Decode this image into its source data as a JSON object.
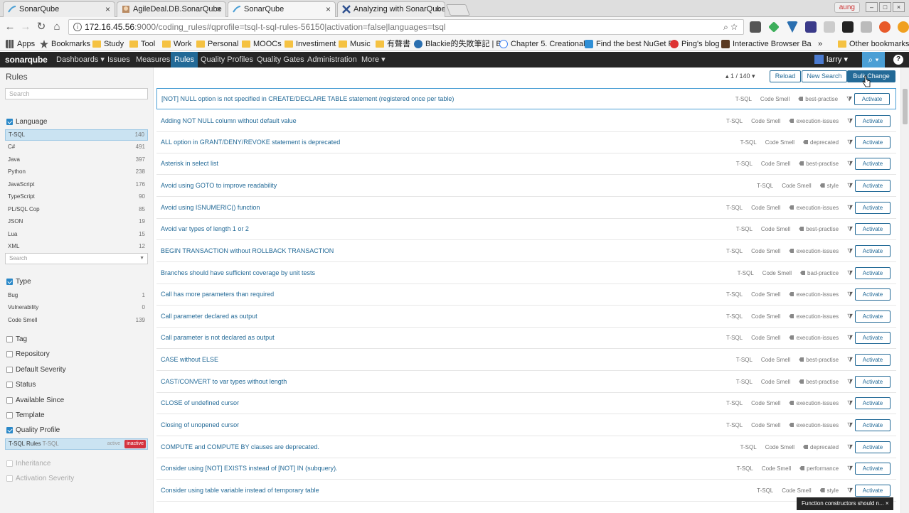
{
  "browser": {
    "tabs": [
      {
        "title": "SonarQube"
      },
      {
        "title": "AgileDeal.DB.SonarQube"
      },
      {
        "title": "SonarQube"
      },
      {
        "title": "Analyzing with SonarQube"
      }
    ],
    "user_chip": "aung",
    "url_host": "172.16.45.56",
    "url_path": ":9000/coding_rules#qprofile=tsql-t-sql-rules-56150|activation=false|languages=tsql",
    "bookmarks": [
      {
        "label": "Apps",
        "kind": "grid"
      },
      {
        "label": "Bookmarks",
        "kind": "star"
      },
      {
        "label": "Study",
        "kind": "folder"
      },
      {
        "label": "Tool",
        "kind": "folder"
      },
      {
        "label": "Work",
        "kind": "folder"
      },
      {
        "label": "Personal",
        "kind": "folder"
      },
      {
        "label": "MOOCs",
        "kind": "folder"
      },
      {
        "label": "Investiment",
        "kind": "folder"
      },
      {
        "label": "Music",
        "kind": "folder"
      },
      {
        "label": "有聲書",
        "kind": "folder"
      },
      {
        "label": "Blackie的失敗筆記 | Bl",
        "kind": "site"
      },
      {
        "label": "Chapter 5. Creational",
        "kind": "site"
      },
      {
        "label": "Find the best NuGet P",
        "kind": "site"
      },
      {
        "label": "Ping's blog",
        "kind": "site"
      },
      {
        "label": "Interactive Browser Ba",
        "kind": "site"
      },
      {
        "label": "»",
        "kind": "more"
      },
      {
        "label": "Other bookmarks",
        "kind": "folder"
      }
    ]
  },
  "nav": {
    "logo": "sonarqube",
    "items": [
      "Dashboards ▾",
      "Issues",
      "Measures",
      "Rules",
      "Quality Profiles",
      "Quality Gates",
      "Administration",
      "More ▾"
    ],
    "active": "Rules",
    "user": "larry ▾",
    "search_icon": "search-icon",
    "help": "?"
  },
  "sidebar": {
    "title": "Rules",
    "search_placeholder": "Search",
    "language": {
      "label": "Language",
      "items": [
        {
          "name": "T-SQL",
          "count": "140"
        },
        {
          "name": "C#",
          "count": "491"
        },
        {
          "name": "Java",
          "count": "397"
        },
        {
          "name": "Python",
          "count": "238"
        },
        {
          "name": "JavaScript",
          "count": "176"
        },
        {
          "name": "TypeScript",
          "count": "90"
        },
        {
          "name": "PL/SQL Cop",
          "count": "85"
        },
        {
          "name": "JSON",
          "count": "19"
        },
        {
          "name": "Lua",
          "count": "15"
        },
        {
          "name": "XML",
          "count": "12"
        }
      ],
      "select_placeholder": "Search"
    },
    "type": {
      "label": "Type",
      "items": [
        {
          "name": "Bug",
          "count": "1"
        },
        {
          "name": "Vulnerability",
          "count": "0"
        },
        {
          "name": "Code Smell",
          "count": "139"
        }
      ]
    },
    "collapsed_facets": [
      "Tag",
      "Repository",
      "Default Severity",
      "Status",
      "Available Since",
      "Template"
    ],
    "quality_profile": {
      "label": "Quality Profile",
      "profile": "T-SQL Rules",
      "lang": "T-SQL",
      "active": "active",
      "inactive": "inactive"
    },
    "disabled_facets": [
      "Inheritance",
      "Activation Severity"
    ]
  },
  "main": {
    "pager": "▴ 1 / 140 ▾",
    "buttons": {
      "reload": "Reload",
      "new_search": "New Search",
      "bulk_change": "Bulk Change"
    },
    "activate_label": "Activate",
    "rules": [
      {
        "name": "[NOT] NULL option is not specified in CREATE/DECLARE TABLE statement (registered once per table)",
        "lang": "T-SQL",
        "type": "Code Smell",
        "tag": "best-practise"
      },
      {
        "name": "Adding NOT NULL column without default value",
        "lang": "T-SQL",
        "type": "Code Smell",
        "tag": "execution-issues"
      },
      {
        "name": "ALL option in GRANT/DENY/REVOKE statement is deprecated",
        "lang": "T-SQL",
        "type": "Code Smell",
        "tag": "deprecated"
      },
      {
        "name": "Asterisk in select list",
        "lang": "T-SQL",
        "type": "Code Smell",
        "tag": "best-practise"
      },
      {
        "name": "Avoid using GOTO to improve readability",
        "lang": "T-SQL",
        "type": "Code Smell",
        "tag": "style"
      },
      {
        "name": "Avoid using ISNUMERIC() function",
        "lang": "T-SQL",
        "type": "Code Smell",
        "tag": "execution-issues"
      },
      {
        "name": "Avoid var types of length 1 or 2",
        "lang": "T-SQL",
        "type": "Code Smell",
        "tag": "best-practise"
      },
      {
        "name": "BEGIN TRANSACTION without ROLLBACK TRANSACTION",
        "lang": "T-SQL",
        "type": "Code Smell",
        "tag": "execution-issues"
      },
      {
        "name": "Branches should have sufficient coverage by unit tests",
        "lang": "T-SQL",
        "type": "Code Smell",
        "tag": "bad-practice"
      },
      {
        "name": "Call has more parameters than required",
        "lang": "T-SQL",
        "type": "Code Smell",
        "tag": "execution-issues"
      },
      {
        "name": "Call parameter declared as output",
        "lang": "T-SQL",
        "type": "Code Smell",
        "tag": "execution-issues"
      },
      {
        "name": "Call parameter is not declared as output",
        "lang": "T-SQL",
        "type": "Code Smell",
        "tag": "execution-issues"
      },
      {
        "name": "CASE without ELSE",
        "lang": "T-SQL",
        "type": "Code Smell",
        "tag": "best-practise"
      },
      {
        "name": "CAST/CONVERT to var types without length",
        "lang": "T-SQL",
        "type": "Code Smell",
        "tag": "best-practise"
      },
      {
        "name": "CLOSE of undefined cursor",
        "lang": "T-SQL",
        "type": "Code Smell",
        "tag": "execution-issues"
      },
      {
        "name": "Closing of unopened cursor",
        "lang": "T-SQL",
        "type": "Code Smell",
        "tag": "execution-issues"
      },
      {
        "name": "COMPUTE and COMPUTE BY clauses are deprecated.",
        "lang": "T-SQL",
        "type": "Code Smell",
        "tag": "deprecated"
      },
      {
        "name": "Consider using [NOT] EXISTS instead of [NOT] IN (subquery).",
        "lang": "T-SQL",
        "type": "Code Smell",
        "tag": "performance"
      },
      {
        "name": "Consider using table variable instead of temporary table",
        "lang": "T-SQL",
        "type": "Code Smell",
        "tag": "style"
      }
    ],
    "toast": "Function constructors should n... ×"
  }
}
